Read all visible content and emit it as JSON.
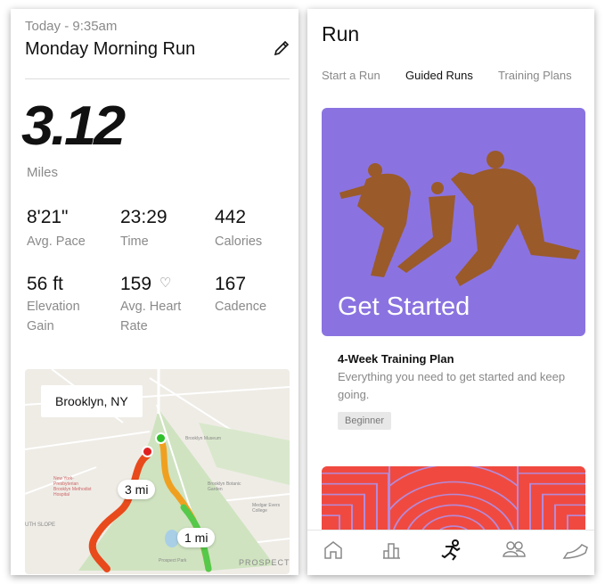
{
  "activity": {
    "timestamp": "Today - 9:35am",
    "title": "Monday Morning Run",
    "distance": "3.12",
    "distance_unit": "Miles",
    "stats": [
      {
        "value": "8'21\"",
        "label": "Avg. Pace"
      },
      {
        "value": "23:29",
        "label": "Time"
      },
      {
        "value": "442",
        "label": "Calories"
      },
      {
        "value": "56 ft",
        "label": "Elevation Gain"
      },
      {
        "value": "159",
        "label": "Avg. Heart Rate"
      },
      {
        "value": "167",
        "label": "Cadence"
      }
    ],
    "map": {
      "location": "Brooklyn, NY",
      "markers": [
        "3 mi",
        "1 mi"
      ],
      "places": [
        "Brooklyn Museum",
        "Brooklyn Botanic Garden",
        "Prospect Park",
        "Medgar Evers College",
        "New York-Presbyterian Brooklyn Methodist Hospital",
        "UTH SLOPE",
        "PROSPECT"
      ]
    }
  },
  "run": {
    "title": "Run",
    "tabs": [
      "Start a Run",
      "Guided Runs",
      "Training Plans"
    ],
    "active_tab": "Guided Runs",
    "card": {
      "hero": "Get Started",
      "title": "4-Week Training Plan",
      "description": "Everything you need to get started and keep going.",
      "badge": "Beginner",
      "color": "#8a73e0"
    },
    "nav": [
      "home-icon",
      "activity-icon",
      "run-icon",
      "club-icon",
      "shoe-icon"
    ]
  }
}
